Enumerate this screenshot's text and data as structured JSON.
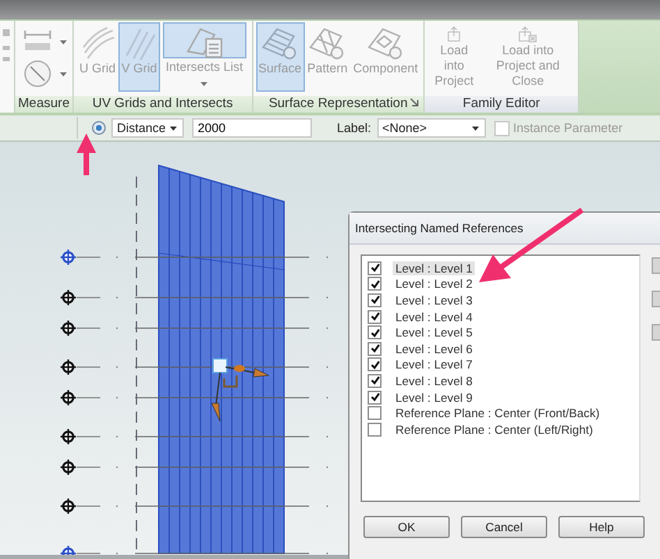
{
  "ribbon": {
    "panels": [
      {
        "title": "Measure"
      },
      {
        "title": "UV Grids and Intersects",
        "tools": [
          {
            "label": "U Grid",
            "selected": false
          },
          {
            "label": "V Grid",
            "selected": true
          },
          {
            "label": "Intersects List",
            "selected": true
          }
        ]
      },
      {
        "title": "Surface Representation",
        "tools": [
          {
            "label": "Surface",
            "selected": true
          },
          {
            "label": "Pattern",
            "selected": false
          },
          {
            "label": "Component",
            "selected": false
          }
        ]
      },
      {
        "title": "Family Editor",
        "tools": [
          {
            "label": "Load into Project",
            "selected": false
          },
          {
            "label": "Load into Project and Close",
            "selected": false
          }
        ]
      }
    ]
  },
  "options_bar": {
    "radio_selected": true,
    "measure": "Distance",
    "value": "2000",
    "label_caption": "Label:",
    "label_value": "<None>",
    "instance_parameter": {
      "label": "Instance Parameter",
      "checked": false,
      "disabled": true
    }
  },
  "dialog": {
    "title": "Intersecting Named References",
    "items": [
      {
        "label": "Level : Level 1",
        "checked": true,
        "selected": true
      },
      {
        "label": "Level : Level 2",
        "checked": true,
        "selected": false
      },
      {
        "label": "Level : Level 3",
        "checked": true,
        "selected": false
      },
      {
        "label": "Level : Level 4",
        "checked": true,
        "selected": false
      },
      {
        "label": "Level : Level 5",
        "checked": true,
        "selected": false
      },
      {
        "label": "Level : Level 6",
        "checked": true,
        "selected": false
      },
      {
        "label": "Level : Level 7",
        "checked": true,
        "selected": false
      },
      {
        "label": "Level : Level 8",
        "checked": true,
        "selected": false
      },
      {
        "label": "Level : Level 9",
        "checked": true,
        "selected": false
      },
      {
        "label": "Reference Plane : Center (Front/Back)",
        "checked": false,
        "selected": false
      },
      {
        "label": "Reference Plane : Center (Left/Right)",
        "checked": false,
        "selected": false
      }
    ],
    "buttons": [
      "OK",
      "Cancel",
      "Help"
    ]
  }
}
